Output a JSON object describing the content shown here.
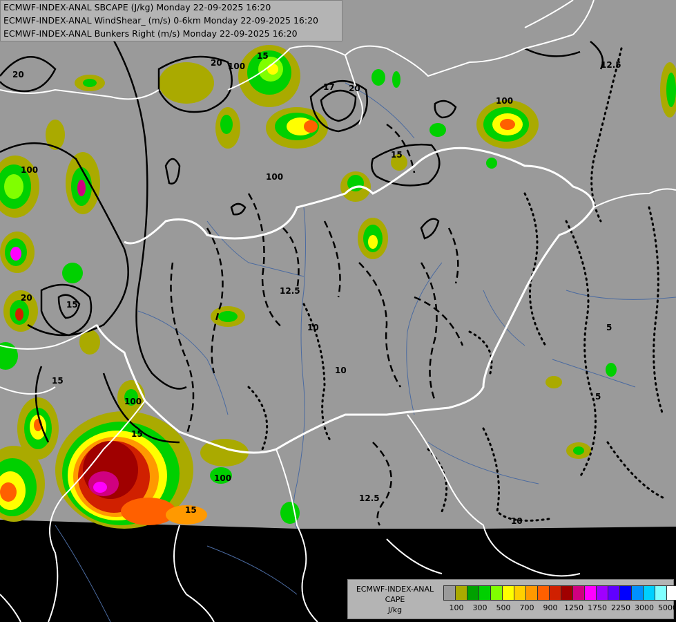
{
  "titles": [
    "ECMWF-INDEX-ANAL SBCAPE (J/kg) Monday 22-09-2025 16:20",
    "ECMWF-INDEX-ANAL WindShear_ (m/s) 0-6km Monday 22-09-2025 16:20",
    "ECMWF-INDEX-ANAL Bunkers Right (m/s) Monday 22-09-2025 16:20"
  ],
  "legend": {
    "line1": "ECMWF-INDEX-ANAL",
    "line2": "CAPE",
    "line3": "J/kg",
    "colors": [
      "#9a9a9a",
      "#aaaa00",
      "#00a000",
      "#00d000",
      "#80ff00",
      "#ffff00",
      "#ffd000",
      "#ff9900",
      "#ff6000",
      "#d02000",
      "#a00000",
      "#d00080",
      "#ff00ff",
      "#a000ff",
      "#6000ff",
      "#0000ff",
      "#0090ff",
      "#00d0ff",
      "#80ffff",
      "#ffffff"
    ],
    "ticks": [
      "100",
      "300",
      "500",
      "700",
      "900",
      "1250",
      "1750",
      "2250",
      "3000",
      "5000"
    ]
  },
  "contour_labels": [
    "20",
    "20",
    "100",
    "15",
    "17",
    "20",
    "12.5",
    "100",
    "15",
    "100",
    "100",
    "15",
    "12.5",
    "10",
    "10",
    "5",
    "5",
    "10",
    "12.5",
    "15",
    "15",
    "100",
    "100",
    "20",
    "15"
  ]
}
